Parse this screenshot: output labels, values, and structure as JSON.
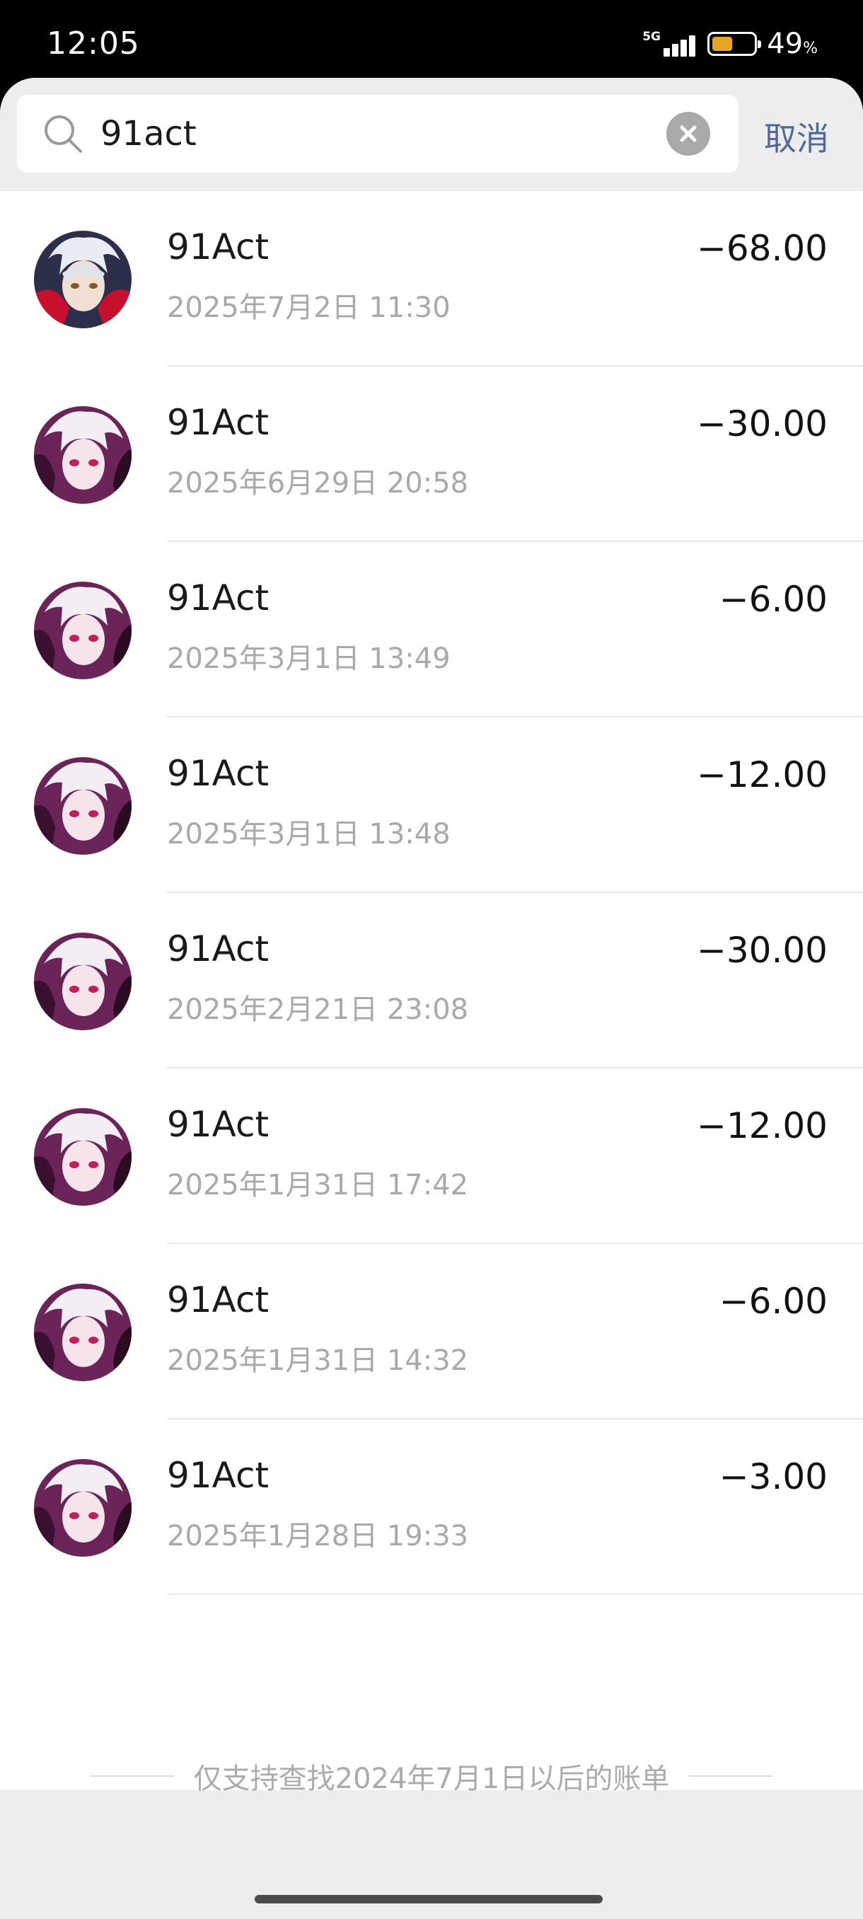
{
  "status_bar": {
    "time": "12:05",
    "network": "5G",
    "battery_level": 0.49,
    "battery_percent": "49",
    "battery_unit": "%"
  },
  "search": {
    "query": "91act",
    "cancel_label": "取消"
  },
  "transactions": [
    {
      "title": "91Act",
      "time": "2025年7月2日 11:30",
      "amount": "−68.00"
    },
    {
      "title": "91Act",
      "time": "2025年6月29日 20:58",
      "amount": "−30.00"
    },
    {
      "title": "91Act",
      "time": "2025年3月1日 13:49",
      "amount": "−6.00"
    },
    {
      "title": "91Act",
      "time": "2025年3月1日 13:48",
      "amount": "−12.00"
    },
    {
      "title": "91Act",
      "time": "2025年2月21日 23:08",
      "amount": "−30.00"
    },
    {
      "title": "91Act",
      "time": "2025年1月31日 17:42",
      "amount": "−12.00"
    },
    {
      "title": "91Act",
      "time": "2025年1月31日 14:32",
      "amount": "−6.00"
    },
    {
      "title": "91Act",
      "time": "2025年1月28日 19:33",
      "amount": "−3.00"
    }
  ],
  "footer": {
    "note": "仅支持查找2024年7月1日以后的账单"
  },
  "colors": {
    "accent": "#4e6a98",
    "secondary_text": "#a9a9a9",
    "background": "#ededed",
    "battery": "#e6a623"
  }
}
